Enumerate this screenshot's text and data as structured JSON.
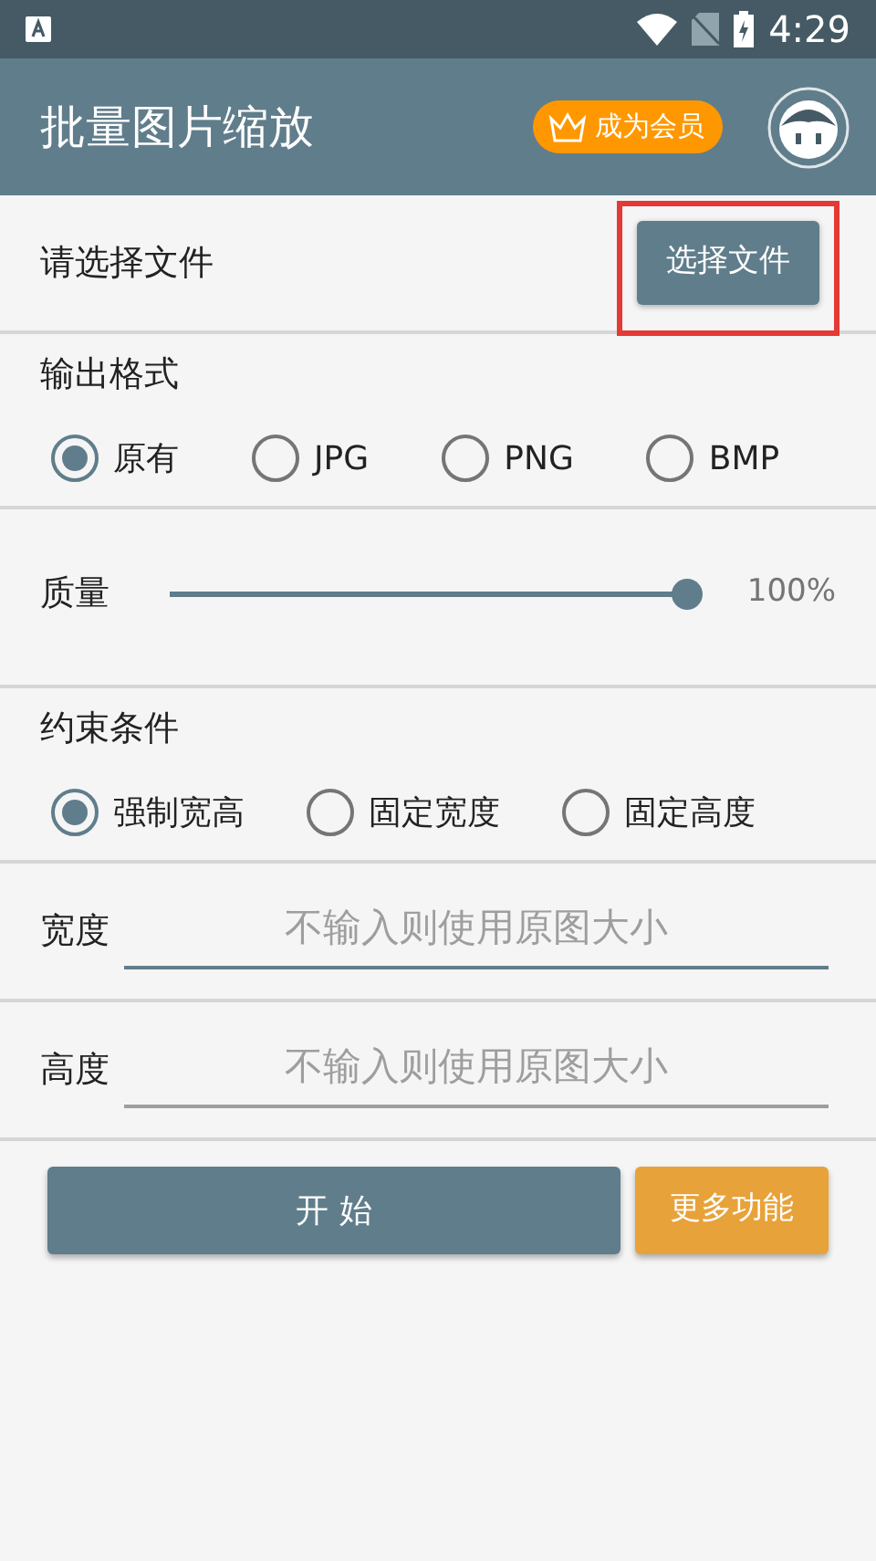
{
  "status_bar": {
    "time": "4:29"
  },
  "app_bar": {
    "title": "批量图片缩放",
    "vip_button": "成为会员"
  },
  "file_row": {
    "label": "请选择文件",
    "button": "选择文件",
    "highlighted": true
  },
  "output_format": {
    "title": "输出格式",
    "options": [
      {
        "label": "原有",
        "selected": true
      },
      {
        "label": "JPG",
        "selected": false
      },
      {
        "label": "PNG",
        "selected": false
      },
      {
        "label": "BMP",
        "selected": false
      }
    ]
  },
  "quality": {
    "label": "质量",
    "level": 1.0,
    "reading": "100%"
  },
  "constraint": {
    "title": "约束条件",
    "options": [
      {
        "label": "强制宽高",
        "selected": true
      },
      {
        "label": "固定宽度",
        "selected": false
      },
      {
        "label": "固定高度",
        "selected": false
      }
    ]
  },
  "fields": [
    {
      "label": "宽度",
      "placeholder": "不输入则使用原图大小",
      "focused": true
    },
    {
      "label": "高度",
      "placeholder": "不输入则使用原图大小",
      "focused": false
    }
  ],
  "buttons": {
    "start": "开 始",
    "more": "更多功能"
  }
}
